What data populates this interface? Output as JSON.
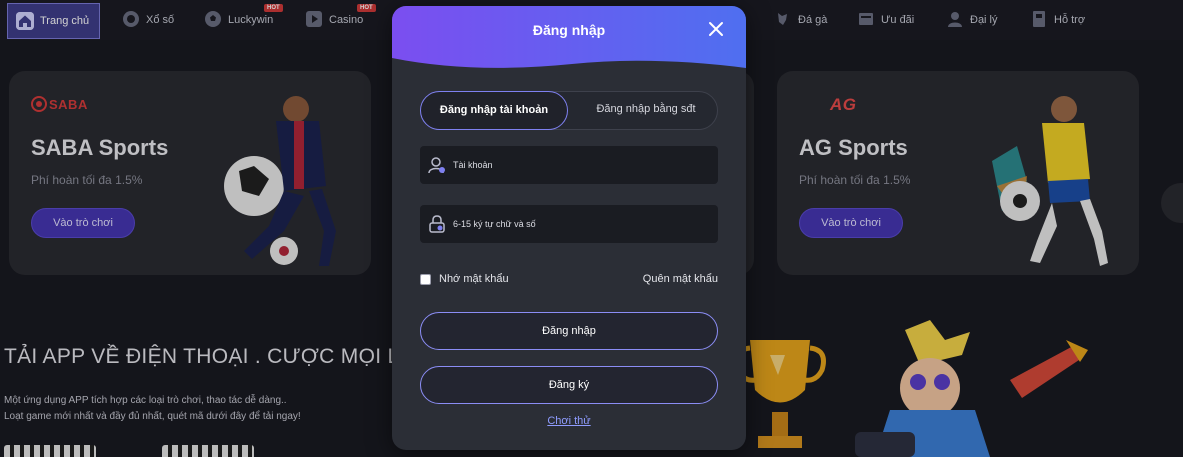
{
  "nav": {
    "items": [
      {
        "label": "Trang chủ",
        "icon": "home-icon"
      },
      {
        "label": "Xổ số",
        "icon": "lottery-icon"
      },
      {
        "label": "Luckywin",
        "icon": "soccer-ball-icon",
        "badge": "HOT"
      },
      {
        "label": "Casino",
        "icon": "play-icon",
        "badge": "HOT"
      },
      {
        "label": "Đá gà",
        "icon": "rooster-icon"
      },
      {
        "label": "Ưu đãi",
        "icon": "gift-icon"
      },
      {
        "label": "Đại lý",
        "icon": "agent-icon"
      },
      {
        "label": "Hỗ trợ",
        "icon": "support-icon"
      }
    ]
  },
  "cards": [
    {
      "logo": "SABA",
      "title": "SABA Sports",
      "subtitle": "Phí hoàn tối đa 1.5%",
      "button": "Vào trò chơi"
    },
    {
      "logo": "AG",
      "title": "AG Sports",
      "subtitle": "Phí hoàn tối đa 1.5%",
      "button": "Vào trò chơi"
    }
  ],
  "app": {
    "title": "TẢI APP VỀ ĐIỆN THOẠI . CƯỢC MỌI LÚ",
    "desc_line1": "Một ứng dụng APP tích hợp các loại trò chơi, thao tác dễ dàng..",
    "desc_line2": "Loạt game mới nhất và đầy đủ nhất, quét mã dưới đây để tải ngay!"
  },
  "modal": {
    "title": "Đăng nhập",
    "tab_account": "Đăng nhập tài khoản",
    "tab_phone": "Đăng nhập bằng sđt",
    "username_placeholder": "Tài khoản",
    "password_placeholder": "6-15 ký tự chữ và số",
    "remember": "Nhớ mật khẩu",
    "forgot": "Quên mật khẩu",
    "login_button": "Đăng nhập",
    "register_button": "Đăng ký",
    "try_link": "Chơi thử"
  },
  "colors": {
    "accent": "#7e80f0",
    "header_gradient_start": "#7b4ef0",
    "header_gradient_end": "#4f6ff0",
    "card_button": "#4636b3"
  }
}
